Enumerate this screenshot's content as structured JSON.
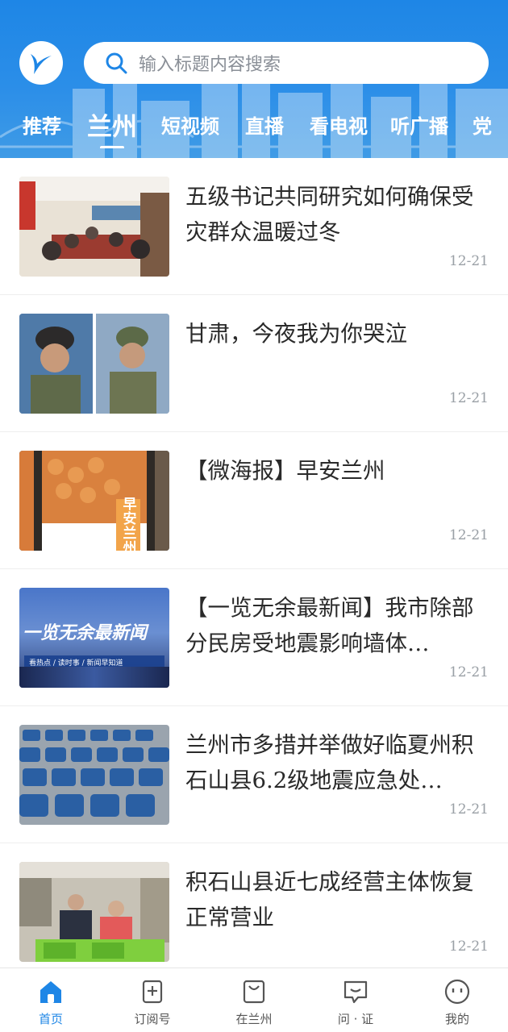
{
  "header": {
    "search_placeholder": "输入标题内容搜索",
    "tabs": [
      {
        "label": "推荐"
      },
      {
        "label": "兰州",
        "active": true
      },
      {
        "label": "短视频"
      },
      {
        "label": "直播"
      },
      {
        "label": "看电视"
      },
      {
        "label": "听广播"
      },
      {
        "label": "党"
      }
    ]
  },
  "feed": {
    "items": [
      {
        "title": "五级书记共同研究如何确保受灾群众温暖过冬",
        "date": "12-21"
      },
      {
        "title": "甘肃，今夜我为你哭泣",
        "date": "12-21"
      },
      {
        "title": "【微海报】早安兰州",
        "date": "12-21",
        "thumb_text": [
          "早",
          "安",
          "兰",
          "州"
        ]
      },
      {
        "title": "【一览无余最新闻】我市除部分民房受地震影响墙体…",
        "date": "12-21",
        "thumb_text": [
          "一览无余最新闻",
          "看热点 / 读时事 / 新闻早知道"
        ]
      },
      {
        "title": "兰州市多措并举做好临夏州积石山县6.2级地震应急处…",
        "date": "12-21"
      },
      {
        "title": "积石山县近七成经营主体恢复正常营业",
        "date": "12-21"
      }
    ]
  },
  "bottom_nav": [
    {
      "label": "首页",
      "icon": "home-icon",
      "active": true
    },
    {
      "label": "订阅号",
      "icon": "subscribe-icon"
    },
    {
      "label": "在兰州",
      "icon": "bag-icon"
    },
    {
      "label": "问 · 证",
      "icon": "chat-icon"
    },
    {
      "label": "我的",
      "icon": "profile-icon"
    }
  ],
  "colors": {
    "brand": "#1e86e6",
    "date": "#9aa0a6"
  }
}
